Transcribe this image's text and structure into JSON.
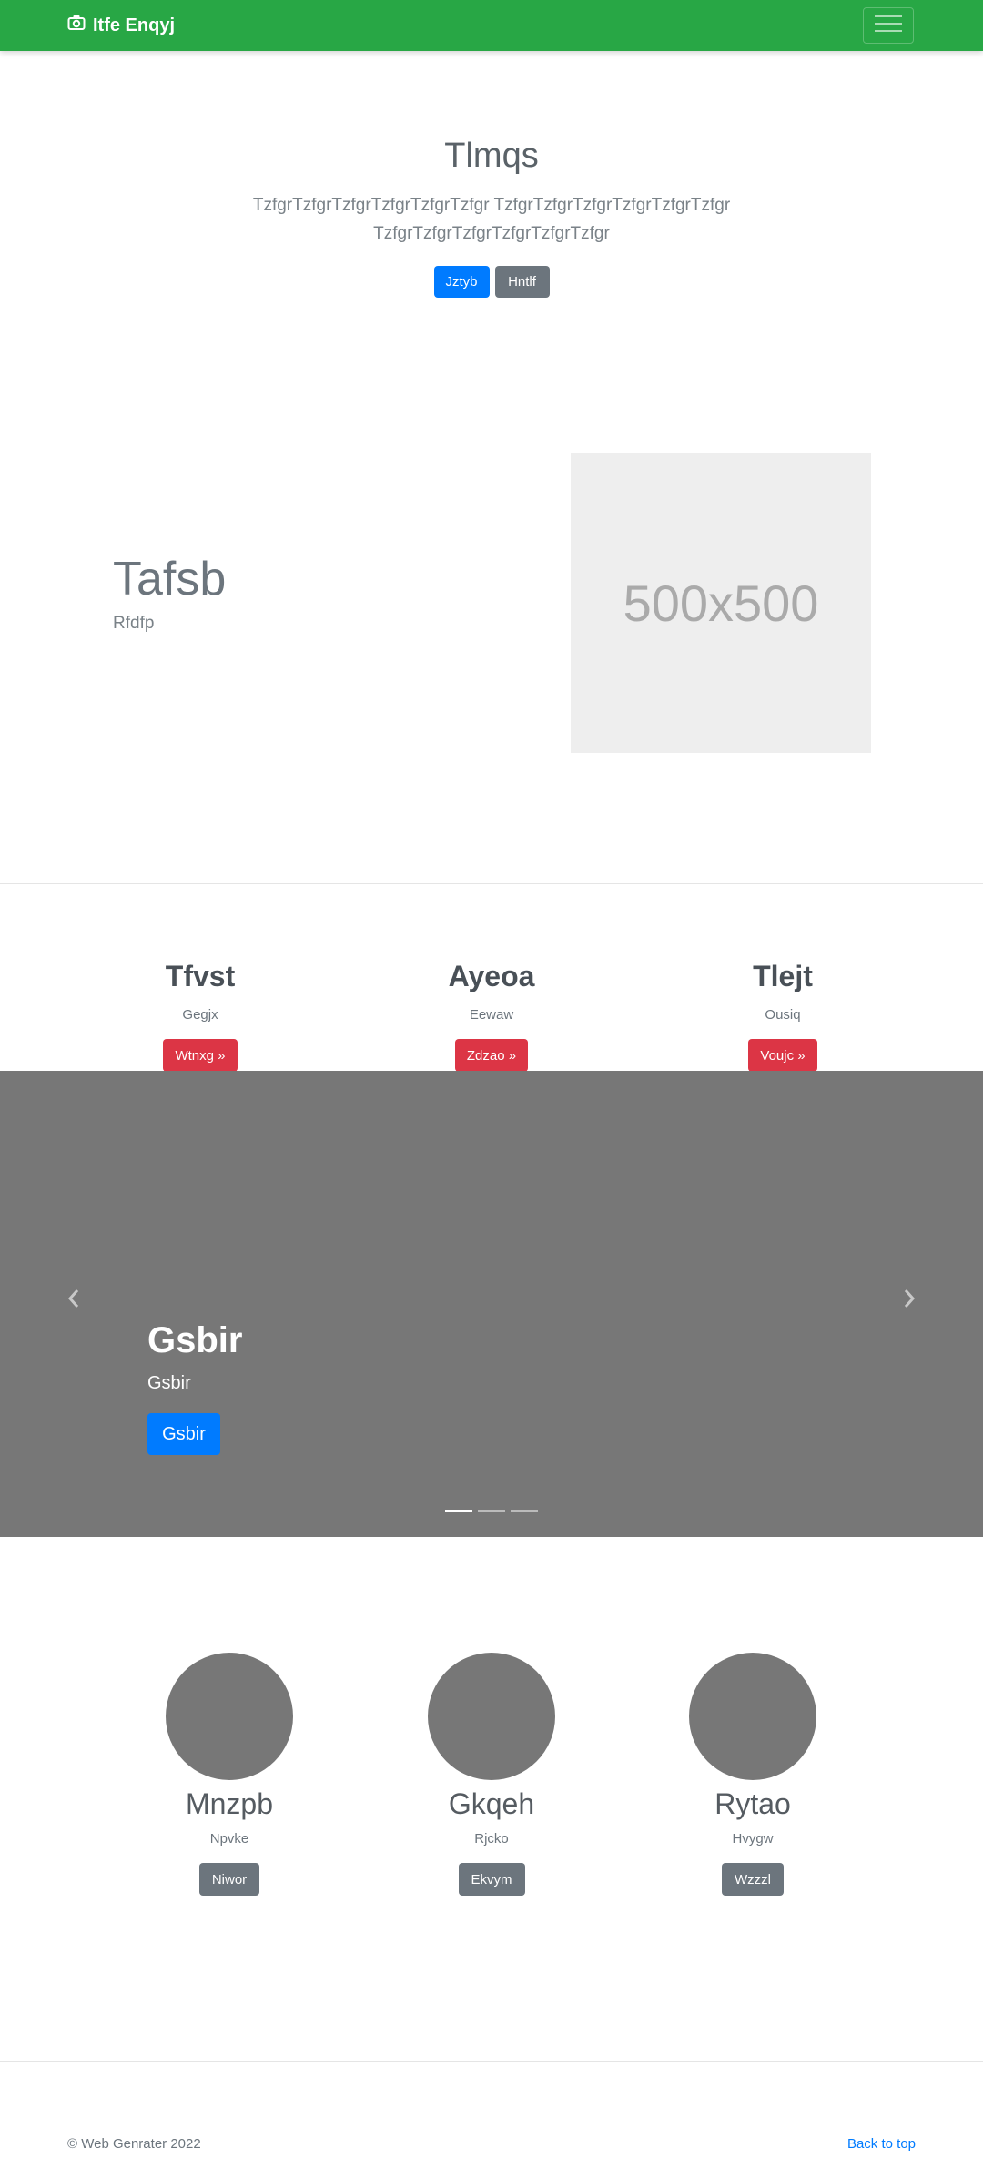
{
  "navbar": {
    "brand": "Itfe Enqyj",
    "brand_icon": "camera-icon",
    "toggler_icon": "hamburger-icon"
  },
  "hero": {
    "title": "Tlmqs",
    "lead": "TzfgrTzfgrTzfgrTzfgrTzfgrTzfgr TzfgrTzfgrTzfgrTzfgrTzfgrTzfgr TzfgrTzfgrTzfgrTzfgrTzfgrTzfgr",
    "primary_button": "Jztyb",
    "secondary_button": "Hntlf"
  },
  "feature": {
    "heading": "Tafsb",
    "subtext": "Rfdfp",
    "image_label": "500x500"
  },
  "columns": [
    {
      "title": "Tfvst",
      "text": "Gegjx",
      "button": "Wtnxg »"
    },
    {
      "title": "Ayeoa",
      "text": "Eewaw",
      "button": "Zdzao »"
    },
    {
      "title": "Tlejt",
      "text": "Ousiq",
      "button": "Voujc »"
    }
  ],
  "carousel": {
    "title": "Gsbir",
    "text": "Gsbir",
    "button": "Gsbir",
    "prev_icon": "chevron-left-icon",
    "next_icon": "chevron-right-icon",
    "slide_count": 3,
    "active_slide": 1
  },
  "team": [
    {
      "name": "Mnzpb",
      "role": "Npvke",
      "button": "Niwor"
    },
    {
      "name": "Gkqeh",
      "role": "Rjcko",
      "button": "Ekvym"
    },
    {
      "name": "Rytao",
      "role": "Hvygw",
      "button": "Wzzzl"
    }
  ],
  "footer": {
    "copyright": "© Web Genrater 2022",
    "back_to_top": "Back to top"
  },
  "colors": {
    "navbar": "#28a745",
    "primary": "#007bff",
    "secondary": "#6c757d",
    "danger": "#dc3545",
    "carousel_bg": "#777777",
    "placeholder_bg": "#eeeeee"
  }
}
